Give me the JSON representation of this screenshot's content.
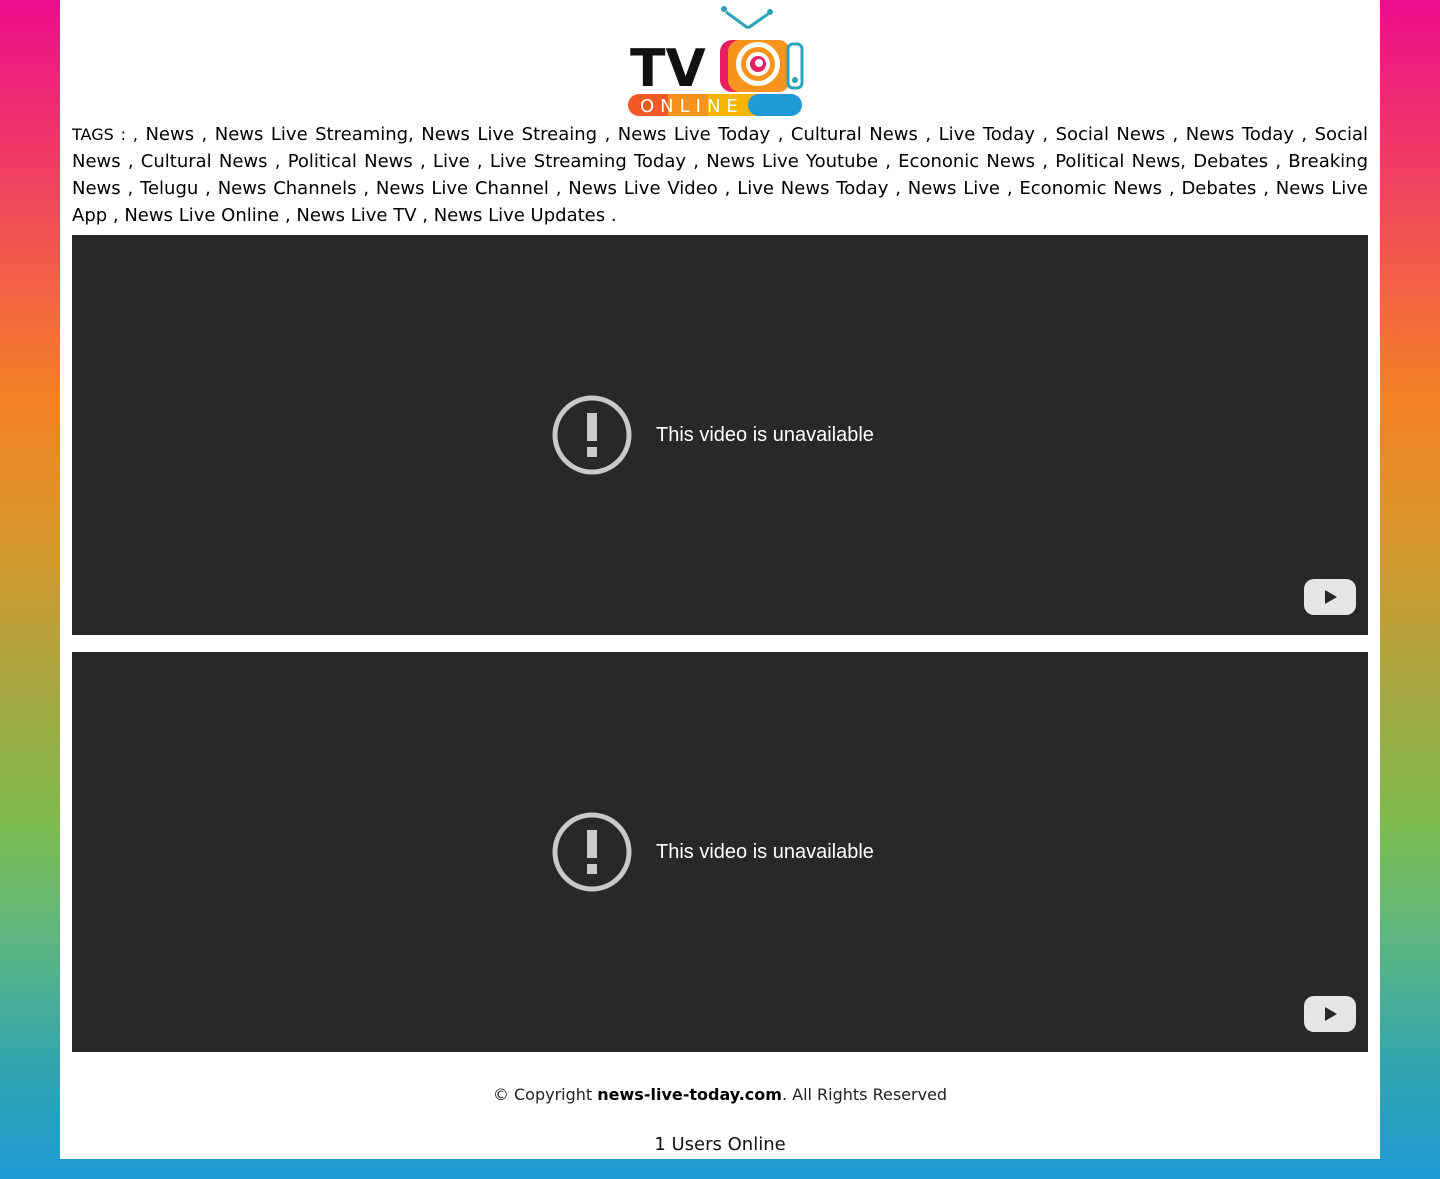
{
  "logo": {
    "text_tv": "TV",
    "text_online": "ONLINE"
  },
  "tags": {
    "prefix": "TAGS : ,",
    "list": "News , News Live Streaming, News Live Streaing , News Live Today , Cultural News , Live Today , Social News , News Today , Social News , Cultural News , Political News , Live , Live Streaming Today , News Live Youtube , Econonic News , Political News, Debates , Breaking News , Telugu , News Channels , News Live Channel , News Live Video , Live News Today , News Live , Economic News , Debates , News Live App , News Live Online , News Live TV , News Live Updates ."
  },
  "videos": [
    {
      "message": "This video is unavailable"
    },
    {
      "message": "This video is unavailable"
    }
  ],
  "footer": {
    "copyright_prefix": "© Copyright",
    "site": "news-live-today.com",
    "rights": ". All Rights Reserved",
    "users_online": "1 Users Online"
  },
  "colors": {
    "video_bg": "#282828",
    "gradient_top": "#ec0c8c",
    "gradient_bottom": "#1e9ad6"
  }
}
